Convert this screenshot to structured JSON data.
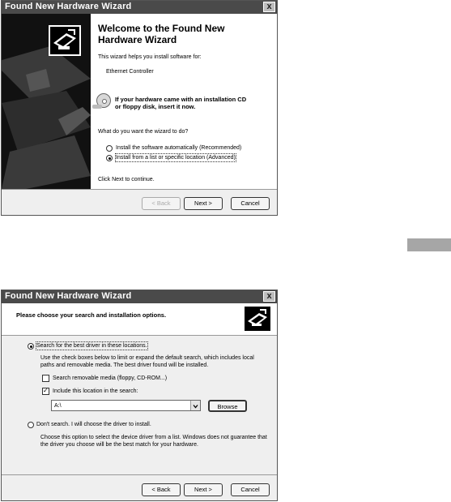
{
  "wizard1": {
    "title": "Found New Hardware Wizard",
    "close_glyph": "x",
    "heading_line1": "Welcome to the Found New",
    "heading_line2": "Hardware Wizard",
    "intro": "This wizard helps you install software for:",
    "device": "Ethernet Controller",
    "cd_line1": "If your hardware came with an installation CD",
    "cd_line2": "or floppy disk, insert it now.",
    "question": "What do you want the wizard to do?",
    "option_auto": "Install the software automatically (Recommended)",
    "option_list": "Install from a list or specific location (Advanced)",
    "selected_option": "option_list",
    "continue": "Click Next to continue.",
    "back_label": "< Back",
    "next_label": "Next >",
    "cancel_label": "Cancel"
  },
  "wizard2": {
    "title": "Found New Hardware Wizard",
    "close_glyph": "x",
    "heading": "Please choose your search and installation options.",
    "option_search": "Search for the best driver in these locations.",
    "search_desc_line1": "Use the check boxes below to limit or expand the default search, which includes local",
    "search_desc_line2": "paths and removable media. The best driver found will be installed.",
    "check_removable": "Search removable media (floppy, CD-ROM...)",
    "check_removable_checked": false,
    "check_location": "Include this location in the search:",
    "check_location_checked": true,
    "location_value": "A:\\",
    "browse_label": "Browse",
    "option_dont": "Don't search. I will choose the driver to install.",
    "dont_desc_line1": "Choose this option to select the device driver from a list.  Windows does not guarantee that",
    "dont_desc_line2": "the driver you choose will be the best match for your hardware.",
    "selected_option": "option_search",
    "back_label": "< Back",
    "next_label": "Next >",
    "cancel_label": "Cancel"
  },
  "side_tab": {
    "color": "#a6a6a6"
  }
}
